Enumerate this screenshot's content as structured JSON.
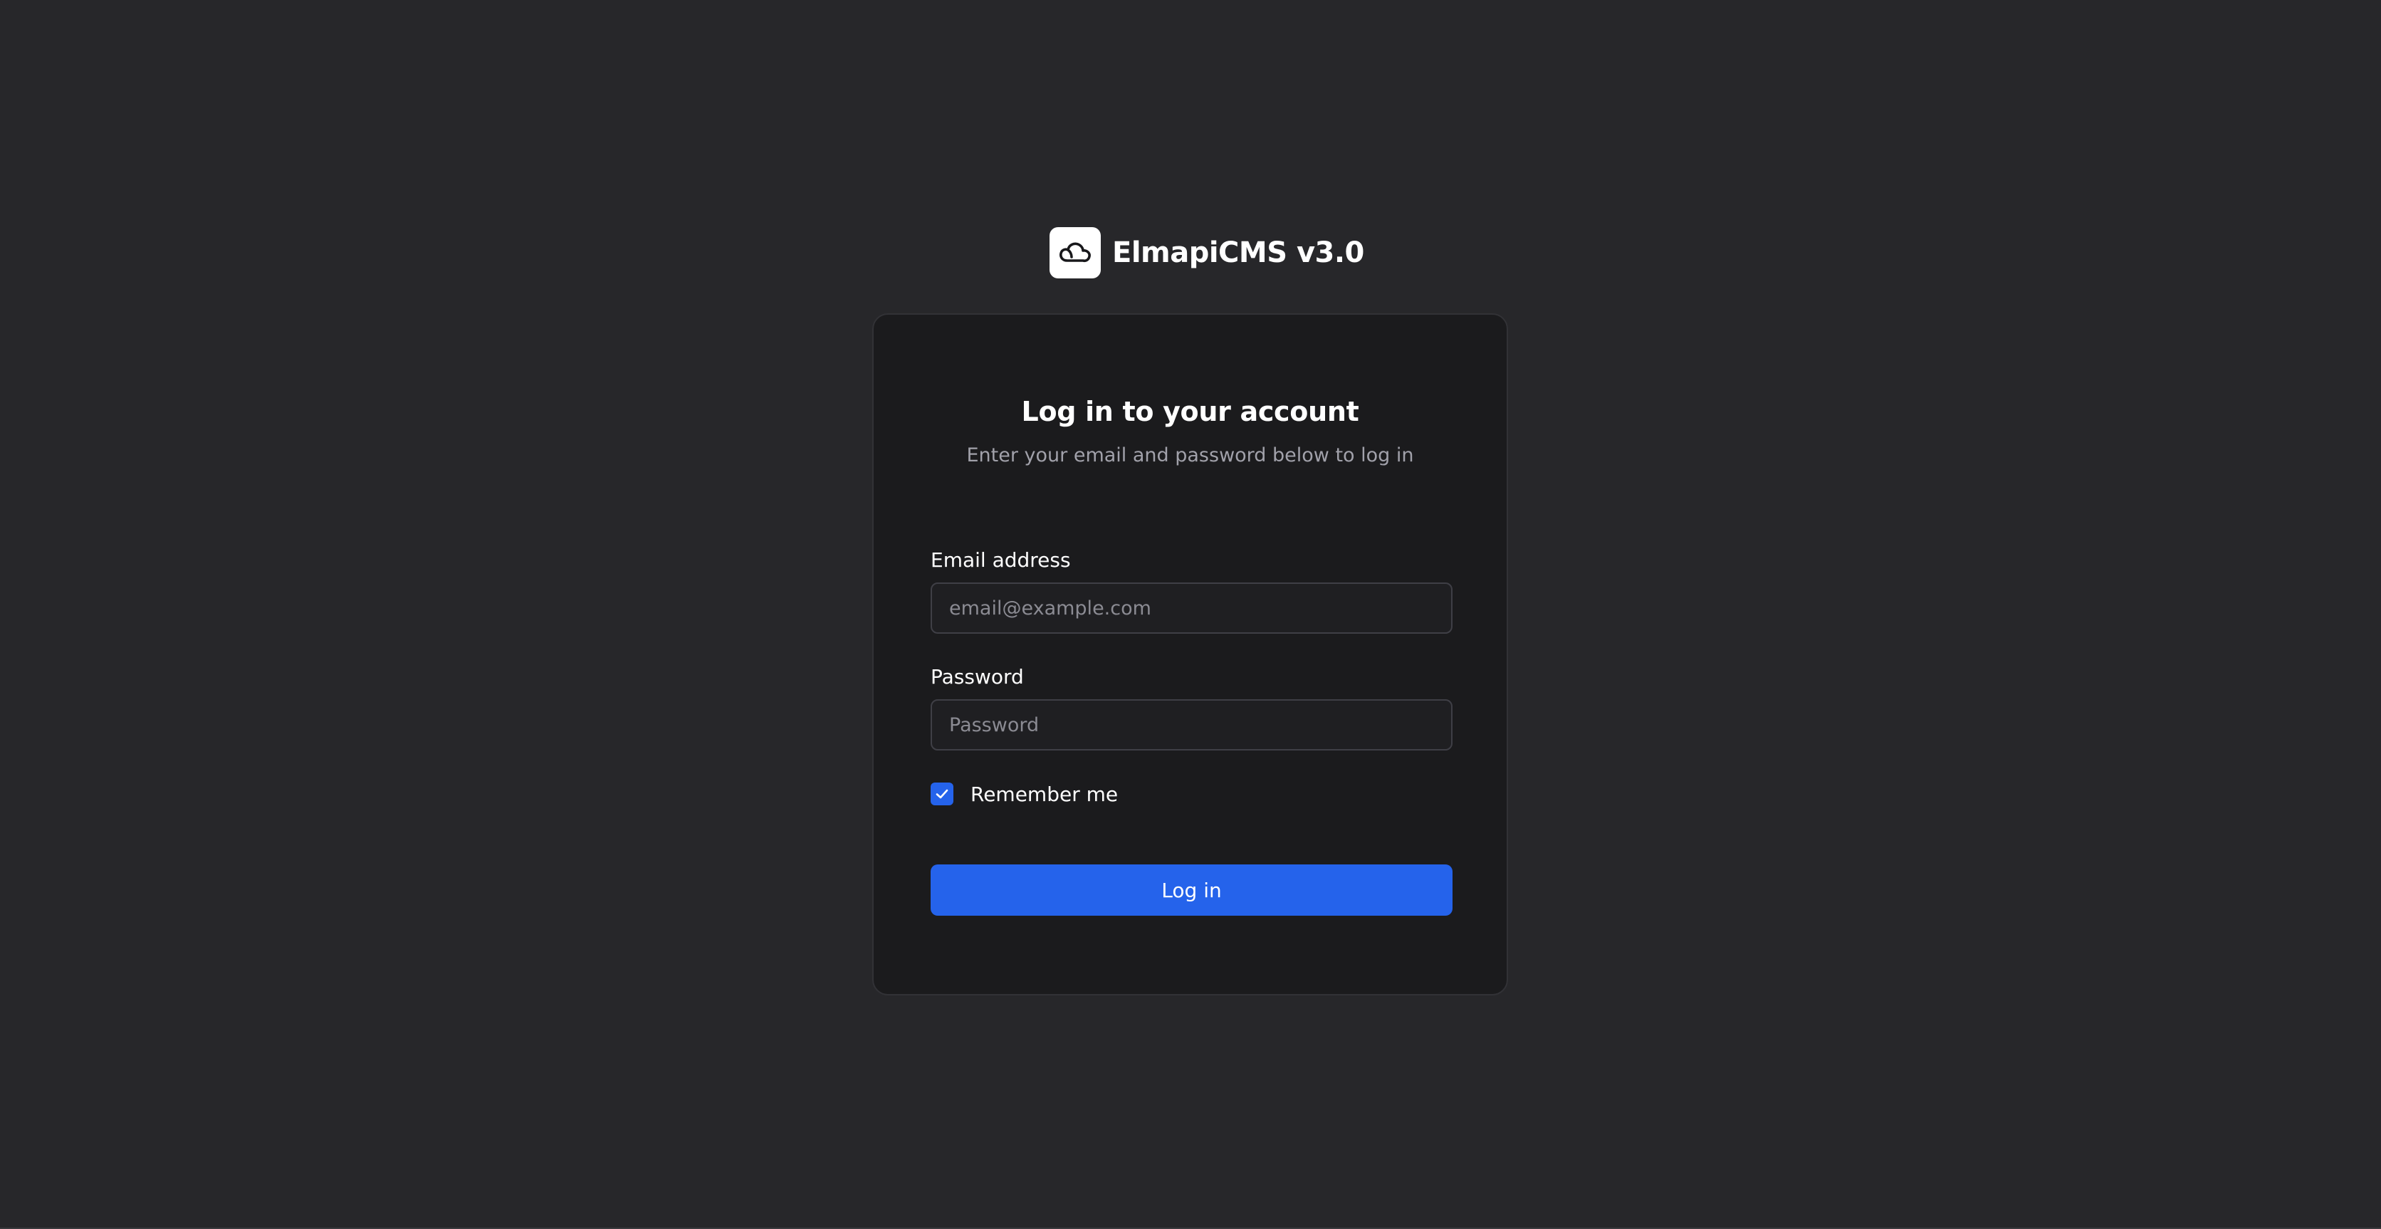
{
  "brand": {
    "name": "ElmapiCMS v3.0",
    "logo_icon": "cloud-icon"
  },
  "card": {
    "title": "Log in to your account",
    "subtitle": "Enter your email and password below to log in"
  },
  "form": {
    "email": {
      "label": "Email address",
      "placeholder": "email@example.com",
      "value": ""
    },
    "password": {
      "label": "Password",
      "placeholder": "Password",
      "value": ""
    },
    "remember": {
      "label": "Remember me",
      "checked": true
    },
    "submit_label": "Log in"
  },
  "colors": {
    "background": "#27272a",
    "card": "#1b1b1d",
    "accent": "#2563eb",
    "text": "#ffffff",
    "muted_text": "#a1a1aa"
  }
}
